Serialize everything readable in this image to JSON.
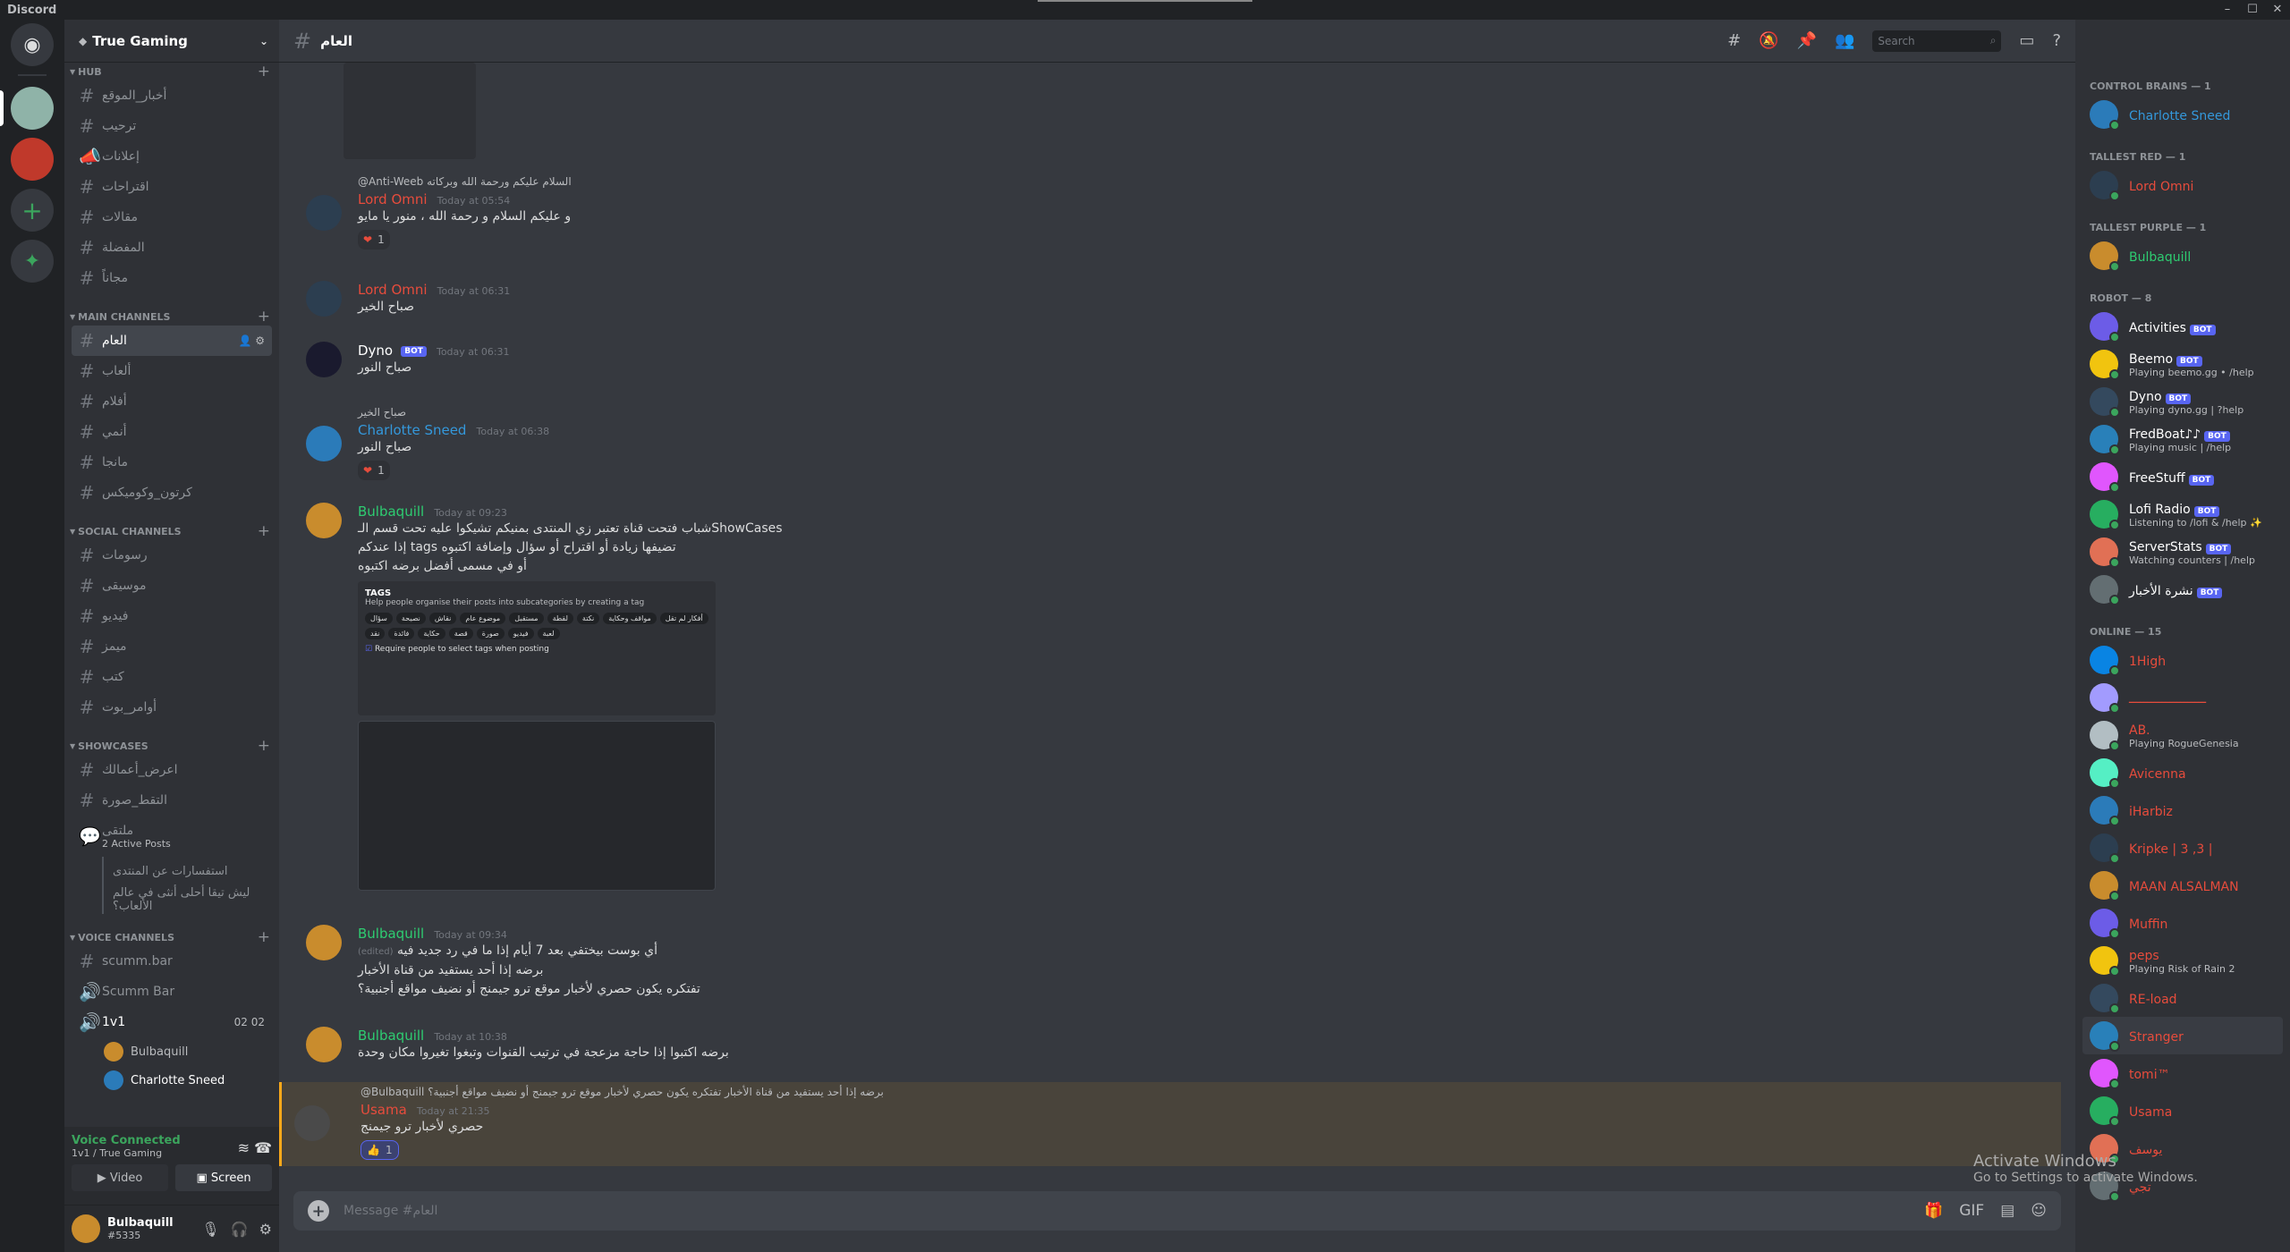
{
  "window": {
    "title": "Discord",
    "controls": [
      "–",
      "☐",
      "✕"
    ]
  },
  "guilds": [
    "home",
    "True Gaming",
    "server-2"
  ],
  "server": {
    "name": "True Gaming"
  },
  "categories": {
    "hub": {
      "label": "HUB",
      "channels": [
        "أخبار_الموقع",
        "ترحيب",
        "إعلانات",
        "اقتراحات",
        "مقالات",
        "المفضلة",
        "مجاناً"
      ]
    },
    "main": {
      "label": "MAIN CHANNELS",
      "channels": [
        "العام",
        "ألعاب",
        "أفلام",
        "أنمي",
        "مانجا",
        "كرتون_وكوميكس"
      ]
    },
    "social": {
      "label": "SOCIAL CHANNELS",
      "channels": [
        "رسومات",
        "موسيقى",
        "فيديو",
        "ميمز",
        "كتب",
        "أوامر_بوت"
      ]
    },
    "showcases": {
      "label": "SHOWCASES",
      "channels": [
        "اعرض_أعمالك",
        "التقط_صورة"
      ],
      "forum": {
        "name": "ملتقى",
        "sub": "2 Active Posts",
        "threads": [
          "استفسارات عن المنتدى",
          "ليش تيقا أحلى أنثى في عالم الألعاب؟"
        ]
      }
    },
    "voice": {
      "label": "VOICE CHANNELS",
      "channels": [
        "scumm.bar",
        "Scumm Bar",
        "1v1"
      ],
      "counts": [
        "02",
        "02"
      ],
      "users": [
        "Bulbaquill",
        "Charlotte Sneed"
      ]
    }
  },
  "voice_panel": {
    "status": "Voice Connected",
    "location": "1v1 / True Gaming",
    "video": "Video",
    "screen": "Screen"
  },
  "user_panel": {
    "name": "Bulbaquill",
    "tag": "#5335"
  },
  "chat": {
    "channel": "العام",
    "search_placeholder": "Search",
    "input_placeholder": "Message #العام"
  },
  "messages": [
    {
      "reply": "@Anti-Weeb السلام عليكم ورحمة الله وبركاته",
      "author": "Lord Omni",
      "time": "Today at 05:54",
      "text": "و عليكم السلام و رحمة الله ، منور يا مايو",
      "reaction": "1"
    },
    {
      "author": "Lord Omni",
      "time": "Today at 06:31",
      "text": "صباح الخير"
    },
    {
      "author": "Dyno",
      "badge": "BOT",
      "time": "Today at 06:31",
      "text": "صباح النور"
    },
    {
      "reply": "صباح الخير",
      "author": "Charlotte Sneed",
      "time": "Today at 06:38",
      "text": "صباح النور",
      "reaction": "1"
    },
    {
      "author": "Bulbaquill",
      "time": "Today at 09:23",
      "lines": [
        "شباب فتحت قناة تعتبر زي المنتدى بمنيكم تشيكوا عليه تحت قسم الـShowCases",
        "إذا عندكم tags تضيفها زيادة أو اقتراح أو سؤال وإضافة اكتبوه",
        "أو في مسمى أفضل برضه اكتبوه"
      ],
      "embed": {
        "title": "TAGS",
        "desc": "Help people organise their posts into subcategories by creating a tag",
        "checkbox": "Require people to select tags when posting",
        "tags": [
          "سؤال",
          "نصيحة",
          "نقاش",
          "موضوع عام",
          "مستقبل",
          "لقطة",
          "نكتة",
          "مواقف وحكاية",
          "أفكار لم تقل",
          "نقد",
          "فائدة",
          "حكاية",
          "قصة",
          "صورة",
          "فيديو",
          "لعبة"
        ]
      }
    },
    {
      "author": "Bulbaquill",
      "time": "Today at 09:34",
      "edited": "(edited)",
      "lines": [
        "أي بوست بيختفي بعد 7 أيام إذا ما في رد جديد فيه",
        "برضه إذا أحد يستفيد من قناة الأخبار",
        "تفتكره يكون حصري لأخبار موقع ترو جيمنج أو نضيف مواقع أجنبية؟"
      ]
    },
    {
      "author": "Bulbaquill",
      "time": "Today at 10:38",
      "text": "برضه اكتبوا إذا حاجة مزعجة في ترتيب القنوات وتبغوا تغيروا مكان وحدة"
    },
    {
      "reply": "@Bulbaquill برضه إذا أحد يستفيد من قناة الأخبار تفتكره يكون حصري لأخبار موقع ترو جيمنج أو نضيف مواقع أجنبية؟",
      "author": "Usama",
      "time": "Today at 21:35",
      "text": "حصري لأخبار ترو جيمنج",
      "reaction": "1"
    }
  ],
  "members": {
    "groups": [
      {
        "label": "CONTROL BRAINS — 1",
        "items": [
          {
            "name": "Charlotte Sneed",
            "color": "#3498db"
          }
        ]
      },
      {
        "label": "TALLEST RED — 1",
        "items": [
          {
            "name": "Lord Omni",
            "color": "#e74c3c"
          }
        ]
      },
      {
        "label": "TALLEST PURPLE — 1",
        "items": [
          {
            "name": "Bulbaquill",
            "color": "#2ecc71"
          }
        ]
      },
      {
        "label": "ROBOT — 8",
        "items": [
          {
            "name": "Activities",
            "color": "#ffffff",
            "bot": "BOT"
          },
          {
            "name": "Beemo",
            "color": "#ffffff",
            "bot": "BOT",
            "act": "Playing beemo.gg • /help"
          },
          {
            "name": "Dyno",
            "color": "#ffffff",
            "bot": "BOT",
            "act": "Playing dyno.gg | ?help"
          },
          {
            "name": "FredBoat♪♪",
            "color": "#ffffff",
            "bot": "BOT",
            "act": "Playing music | /help"
          },
          {
            "name": "FreeStuff",
            "color": "#ffffff",
            "bot": "BOT"
          },
          {
            "name": "Lofi Radio",
            "color": "#ffffff",
            "bot": "BOT",
            "act": "Listening to /lofi & /help ✨"
          },
          {
            "name": "ServerStats",
            "color": "#ffffff",
            "bot": "BOT",
            "act": "Watching counters | /help"
          },
          {
            "name": "نشرة الأخبار",
            "color": "#ffffff",
            "bot": "BOT"
          }
        ]
      },
      {
        "label": "ONLINE — 15",
        "items": [
          {
            "name": "1High",
            "color": "#e74c3c"
          },
          {
            "name": "ـــــــــــــــــــــ",
            "color": "#e74c3c"
          },
          {
            "name": "AB.",
            "color": "#e74c3c",
            "act": "Playing RogueGenesia"
          },
          {
            "name": "Avicenna",
            "color": "#e74c3c"
          },
          {
            "name": "iHarbiz",
            "color": "#e74c3c"
          },
          {
            "name": "Kripke | 3 ,3 |",
            "color": "#e74c3c"
          },
          {
            "name": "MAAN ALSALMAN",
            "color": "#e74c3c"
          },
          {
            "name": "Muffin",
            "color": "#e74c3c"
          },
          {
            "name": "peps",
            "color": "#e74c3c",
            "act": "Playing Risk of Rain 2"
          },
          {
            "name": "RE-load",
            "color": "#e74c3c"
          },
          {
            "name": "Stranger",
            "color": "#e74c3c"
          },
          {
            "name": "tomi™",
            "color": "#e74c3c"
          },
          {
            "name": "Usama",
            "color": "#e74c3c"
          },
          {
            "name": "يوسف",
            "color": "#e74c3c"
          },
          {
            "name": "تجي",
            "color": "#e74c3c"
          }
        ]
      }
    ]
  },
  "watermark": {
    "title": "Activate Windows",
    "sub": "Go to Settings to activate Windows."
  },
  "colors": {
    "lord_omni": "#e74c3c",
    "charlotte": "#3498db",
    "bulbaquill": "#2ecc71",
    "usama": "#e74c3c",
    "dyno": "#ffffff"
  }
}
